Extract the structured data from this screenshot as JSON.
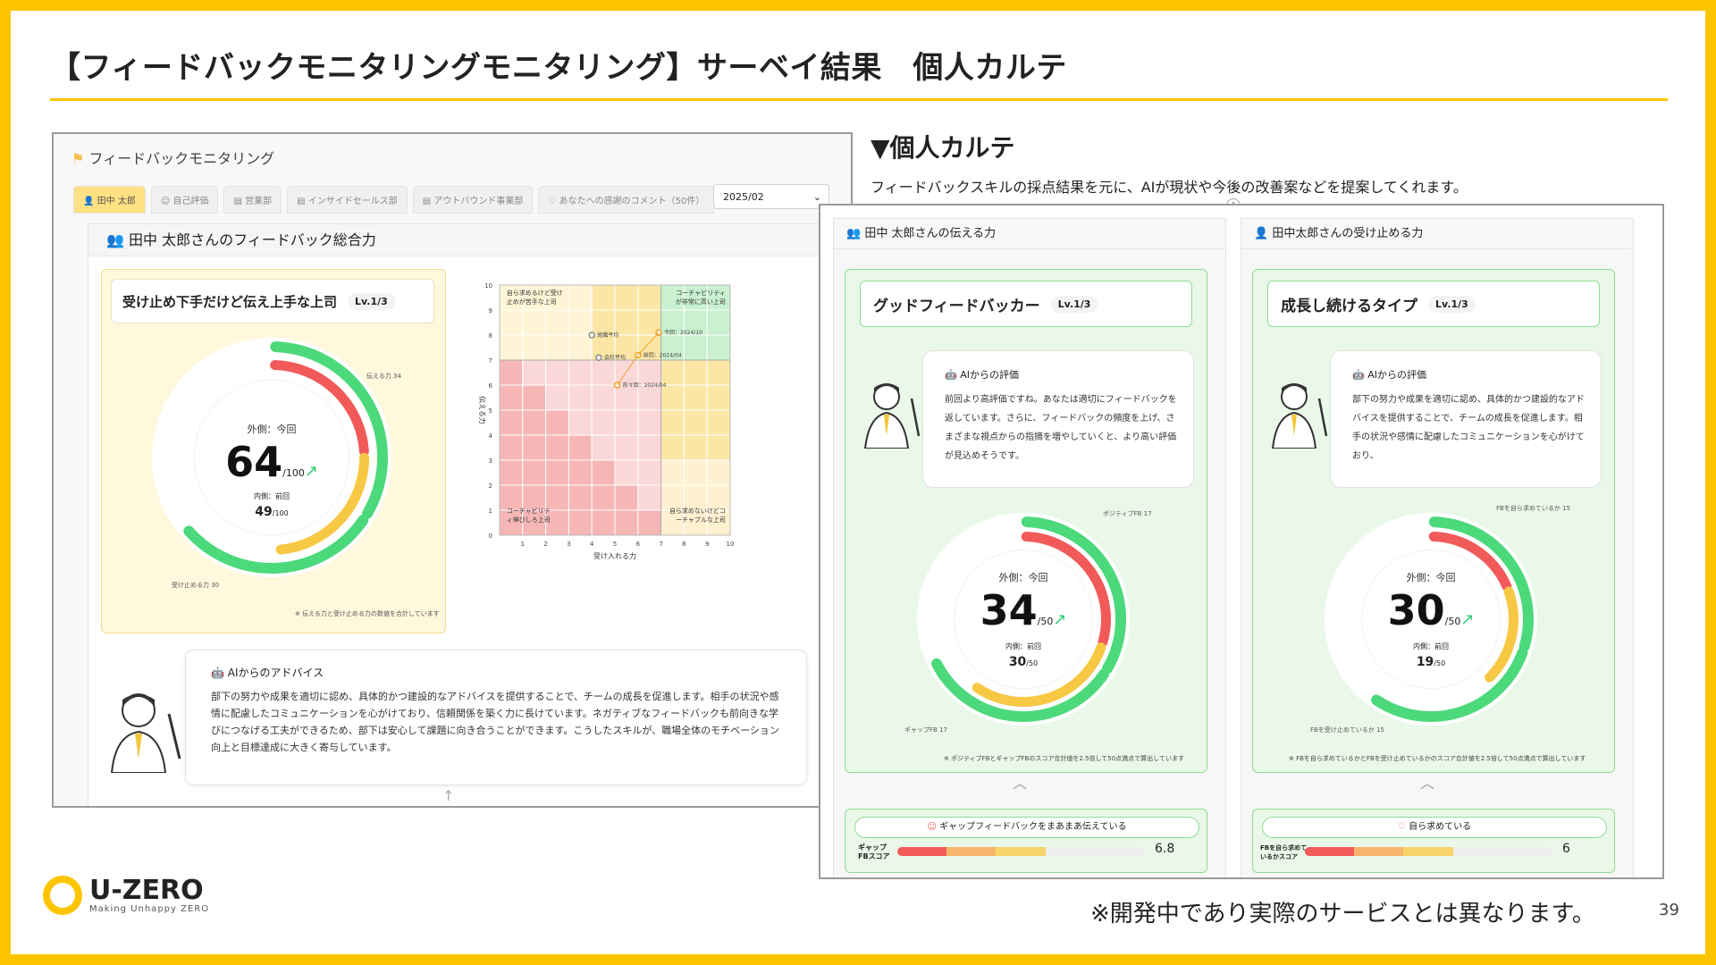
{
  "slide": {
    "title": "【フィードバックモニタリングモニタリング】サーベイ結果　個人カルテ",
    "section_title": "▼個人カルテ",
    "section_desc": "フィードバックスキルの採点結果を元に、AIが現状や今後の改善案などを提案してくれます。",
    "disclaimer": "※開発中であり実際のサービスとは異なります。",
    "page_number": "39",
    "logo_main": "U-ZERO",
    "logo_sub": "Making Unhappy ZERO"
  },
  "app": {
    "header": "フィードバックモニタリング",
    "tabs": [
      "田中 太郎",
      "自己評価",
      "営業部",
      "インサイドセールス部",
      "アウトバウンド事業部",
      "あなたへの感謝のコメント（50件）"
    ],
    "month": "2025/02",
    "panel_title": "田中 太郎さんのフィードバック総合力",
    "type_label": "受け止め下手だけど伝え上手な上司",
    "level": "Lv.1/3",
    "gauge": {
      "outer_label": "外側：今回",
      "score": "64",
      "denom": "/100",
      "inner_label": "内側：前回",
      "prev_score": "49",
      "prev_denom": "/100",
      "tell_label": "伝える力 34",
      "receive_label": "受け止める力 30",
      "note": "※ 伝える力と受け止める力の数値を合計しています",
      "tell_value": 34,
      "receive_value": 30,
      "prev_value": 49
    },
    "advice": {
      "head": "AIからのアドバイス",
      "text": "部下の努力や成果を適切に認め、具体的かつ建設的なアドバイスを提供することで、チームの成長を促進します。相手の状況や感情に配慮したコミュニケーションを心がけており、信頼関係を築く力に長けています。ネガティブなフィードバックも前向きな学びにつなげる工夫ができるため、部下は安心して課題に向き合うことができます。こうしたスキルが、職場全体のモチベーション向上と目標達成に大きく寄与しています。"
    }
  },
  "chart_data": {
    "type": "scatter",
    "xlabel": "受け入れる力",
    "ylabel": "伝える力",
    "xlim": [
      0,
      10
    ],
    "ylim": [
      0,
      10
    ],
    "x_ticks": [
      "1",
      "2",
      "3",
      "4",
      "5",
      "6",
      "7",
      "8",
      "9",
      "10"
    ],
    "y_ticks": [
      "0",
      "1",
      "2",
      "3",
      "4",
      "5",
      "6",
      "7",
      "8",
      "9",
      "10"
    ],
    "quadrants": {
      "top_left": "自ら求めるけど受け止めが苦手な上司",
      "top_right": "コーチャビリティが非常に高い上司",
      "bottom_left": "コーチャビリティ伸びしろ上司",
      "bottom_right": "自ら求めないけどコーチャブルな上司"
    },
    "points": [
      {
        "label": "組織平均",
        "x": 4.0,
        "y": 8.0
      },
      {
        "label": "会社平均",
        "x": 4.3,
        "y": 7.1
      },
      {
        "label": "前回：2024/04",
        "x": 6.0,
        "y": 7.2
      },
      {
        "label": "今回：2024/10",
        "x": 6.9,
        "y": 8.1
      },
      {
        "label": "前々回：2024/04",
        "x": 5.1,
        "y": 6.0
      }
    ]
  },
  "detail": {
    "tell": {
      "header": "田中 太郎さんの伝える力",
      "type_label": "グッドフィードバッカー",
      "level": "Lv.1/3",
      "ai_head": "AIからの評価",
      "ai_text": "前回より高評価ですね。あなたは適切にフィードバックを返しています。さらに、フィードバックの頻度を上げ、さまざまな視点からの指摘を増やしていくと、より高い評価が見込めそうです。",
      "outer_label": "外側：今回",
      "score": "34",
      "denom": "/50",
      "inner_label": "内側：前回",
      "prev_score": "30",
      "prev_denom": "/50",
      "label_top": "ポジティブFB 17",
      "label_bottom": "ギャップFB 17",
      "note": "※ ポジティブFBとギャップFBのスコア合計値を2.5倍して50点満点で算出しています",
      "bottom_label": "ギャップフィードバックをまあまあ伝えている",
      "bar_label": "ギャップFBスコア",
      "bar_value": "6.8",
      "bar_fill": 0.68,
      "seg_a": 17,
      "seg_b": 17,
      "prev_value": 30
    },
    "receive": {
      "header": "田中太郎さんの受け止める力",
      "type_label": "成長し続けるタイプ",
      "level": "Lv.1/3",
      "ai_head": "AIからの評価",
      "ai_text": "部下の努力や成果を適切に認め、具体的かつ建設的なアドバイスを提供することで、チームの成長を促進します。相手の状況や感情に配慮したコミュニケーションを心がけており、",
      "outer_label": "外側：今回",
      "score": "30",
      "denom": "/50",
      "inner_label": "内側：前回",
      "prev_score": "19",
      "prev_denom": "/50",
      "label_top": "FBを自ら求めているか 15",
      "label_bottom": "FBを受け止めているか 15",
      "note": "※ FBを自ら求めているかとFBを受け止めているかのスコア合計値を2.5倍して50点満点で算出しています",
      "bottom_label": "自ら求めている",
      "bar_label": "FBを自ら求めているかスコア",
      "bar_value": "6",
      "bar_fill": 0.6,
      "seg_a": 15,
      "seg_b": 15,
      "prev_value": 19
    }
  },
  "colors": {
    "accent": "#ffc400",
    "green": "#4cd97b",
    "red": "#f25a5a",
    "yellow": "#f7c844"
  }
}
